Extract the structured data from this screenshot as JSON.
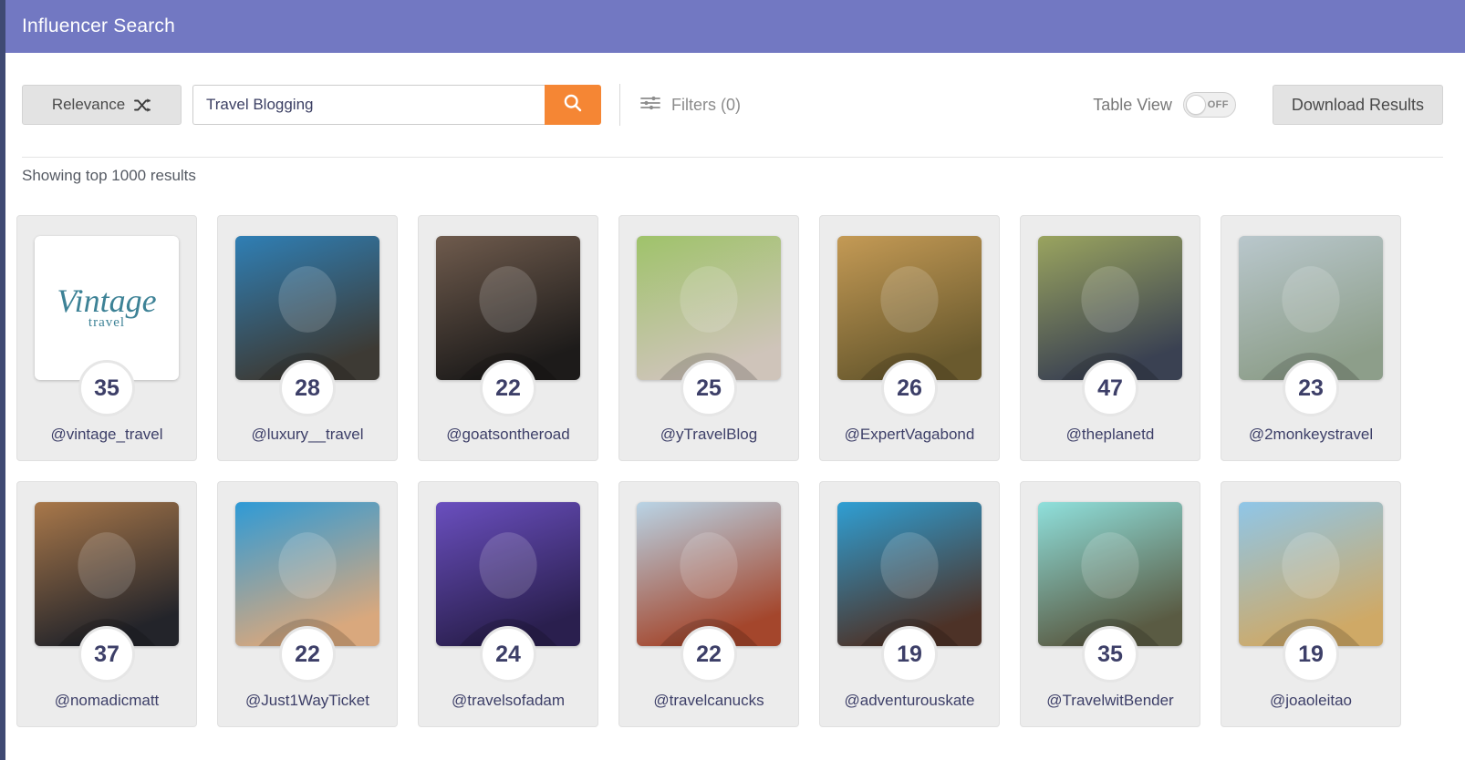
{
  "header": {
    "title": "Influencer Search",
    "bg_color": "#7278c2"
  },
  "toolbar": {
    "sort_label": "Relevance",
    "sort_icon": "shuffle-icon",
    "search_value": "Travel Blogging",
    "search_placeholder": "Search",
    "search_icon": "search-icon",
    "search_button_color": "#f58634",
    "filters_label": "Filters (0)",
    "filters_icon": "sliders-icon",
    "table_view_label": "Table View",
    "table_view_state": "OFF",
    "download_label": "Download Results"
  },
  "results": {
    "count_text": "Showing top 1000 results"
  },
  "cards": [
    {
      "handle": "@vintage_travel",
      "score": "35",
      "image": "logo",
      "logo_word": "Vintage",
      "logo_sub": "travel",
      "c1": "#ffffff",
      "c2": "#ffffff"
    },
    {
      "handle": "@luxury__travel",
      "score": "28",
      "image": "photo",
      "c1": "#2f7fb5",
      "c2": "#3d3a34"
    },
    {
      "handle": "@goatsontheroad",
      "score": "22",
      "image": "photo",
      "c1": "#6f5b4d",
      "c2": "#1d1b1a"
    },
    {
      "handle": "@yTravelBlog",
      "score": "25",
      "image": "photo",
      "c1": "#9fc36a",
      "c2": "#cfc4ba"
    },
    {
      "handle": "@ExpertVagabond",
      "score": "26",
      "image": "photo",
      "c1": "#c49a55",
      "c2": "#6a5a2e"
    },
    {
      "handle": "@theplanetd",
      "score": "47",
      "image": "photo",
      "c1": "#9aa45f",
      "c2": "#3a4152"
    },
    {
      "handle": "@2monkeystravel",
      "score": "23",
      "image": "photo",
      "c1": "#b9c7cc",
      "c2": "#8d9e8a"
    },
    {
      "handle": "@nomadicmatt",
      "score": "37",
      "image": "photo",
      "c1": "#a9784a",
      "c2": "#23242a"
    },
    {
      "handle": "@Just1WayTicket",
      "score": "22",
      "image": "photo",
      "c1": "#2e9ad6",
      "c2": "#d9a87d"
    },
    {
      "handle": "@travelsofadam",
      "score": "24",
      "image": "photo",
      "c1": "#6a4fbf",
      "c2": "#2a1f4e"
    },
    {
      "handle": "@travelcanucks",
      "score": "22",
      "image": "photo",
      "c1": "#b9d4e6",
      "c2": "#a4462c"
    },
    {
      "handle": "@adventurouskate",
      "score": "19",
      "image": "photo",
      "c1": "#2f9fd4",
      "c2": "#4d3227"
    },
    {
      "handle": "@TravelwitBender",
      "score": "35",
      "image": "photo",
      "c1": "#8fe0dc",
      "c2": "#5a5b43"
    },
    {
      "handle": "@joaoleitao",
      "score": "19",
      "image": "photo",
      "c1": "#8fc6e8",
      "c2": "#cfa966"
    }
  ]
}
